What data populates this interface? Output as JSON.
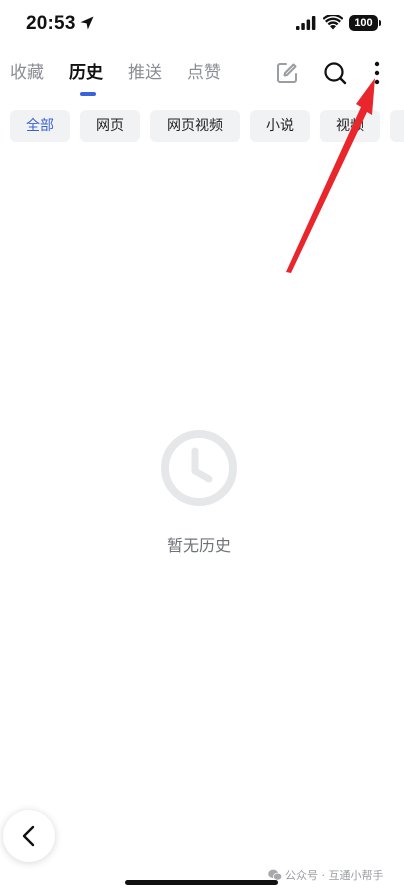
{
  "status_bar": {
    "time": "20:53",
    "battery": "100"
  },
  "tabs": [
    {
      "label": "收藏",
      "active": false
    },
    {
      "label": "历史",
      "active": true
    },
    {
      "label": "推送",
      "active": false
    },
    {
      "label": "点赞",
      "active": false
    }
  ],
  "header_icons": [
    "edit-icon",
    "search-icon",
    "more-vertical-icon"
  ],
  "filters": [
    {
      "label": "全部",
      "active": true
    },
    {
      "label": "网页",
      "active": false
    },
    {
      "label": "网页视频",
      "active": false
    },
    {
      "label": "小说",
      "active": false
    },
    {
      "label": "视频",
      "active": false
    }
  ],
  "empty_state": {
    "icon": "clock-icon",
    "text": "暂无历史"
  },
  "watermark": "公众号 · 互通小帮手",
  "colors": {
    "accent": "#3a62d9",
    "annotation": "#e8262c"
  }
}
